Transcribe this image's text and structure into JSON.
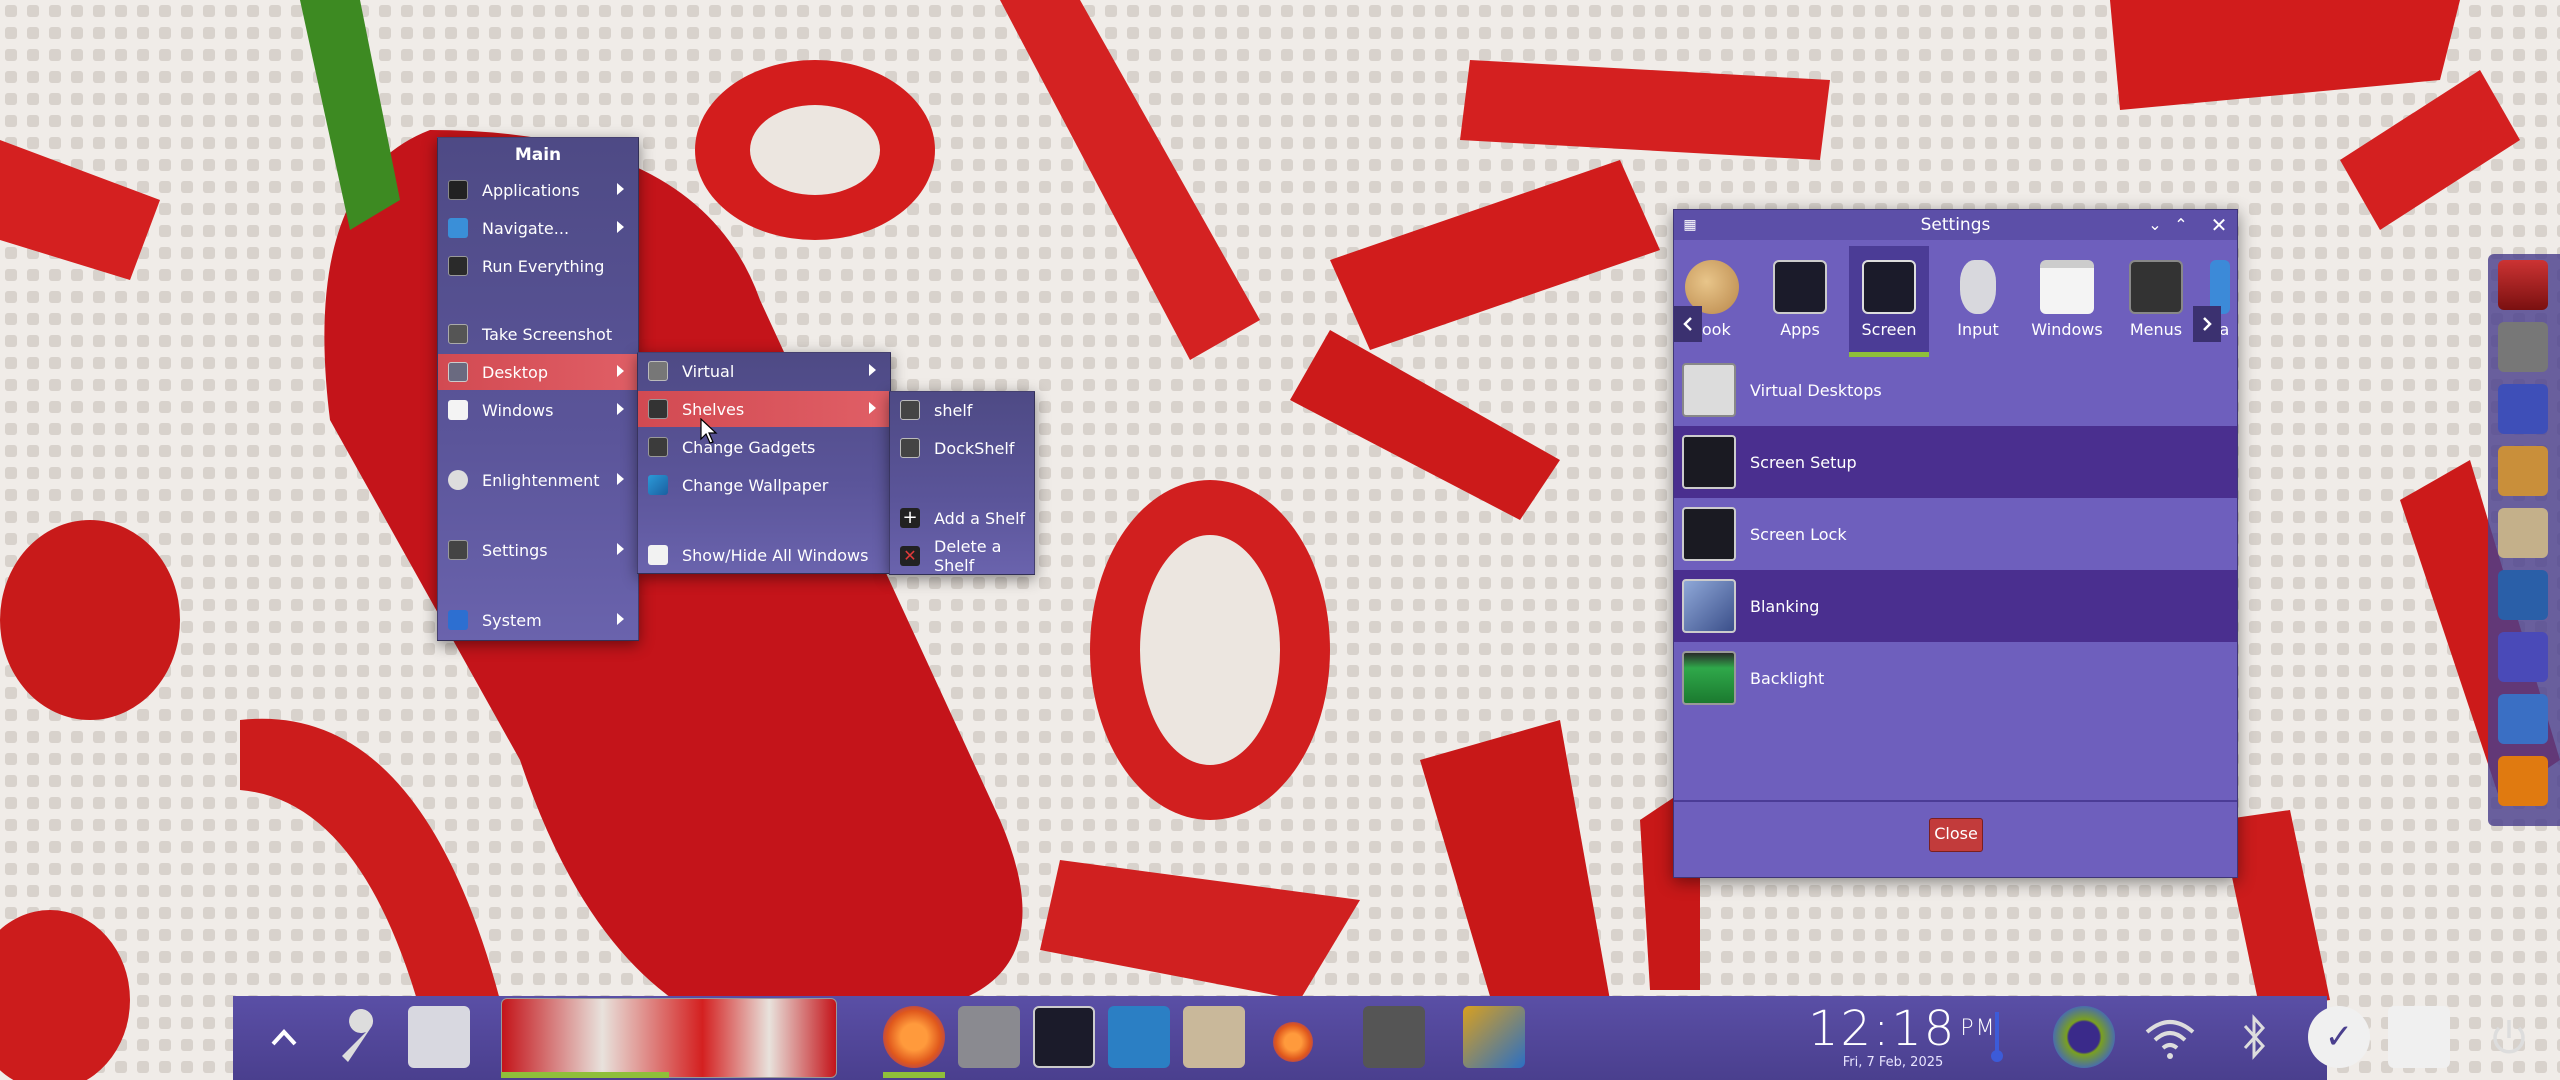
{
  "main_menu": {
    "title": "Main",
    "items": [
      {
        "label": "Applications",
        "icon": "terminal-icon",
        "submenu": true
      },
      {
        "label": "Navigate...",
        "icon": "navigate-icon",
        "submenu": true
      },
      {
        "label": "Run Everything",
        "icon": "search-icon",
        "submenu": false
      },
      {
        "label": "Take Screenshot",
        "icon": "screenshot-icon",
        "submenu": false
      },
      {
        "label": "Desktop",
        "icon": "desktop-icon",
        "submenu": true,
        "selected": true
      },
      {
        "label": "Windows",
        "icon": "windows-icon",
        "submenu": true
      },
      {
        "label": "Enlightenment",
        "icon": "enlightenment-icon",
        "submenu": true
      },
      {
        "label": "Settings",
        "icon": "settings-icon",
        "submenu": true
      },
      {
        "label": "System",
        "icon": "system-icon",
        "submenu": true
      }
    ]
  },
  "desktop_menu": {
    "items": [
      {
        "label": "Virtual",
        "icon": "virtual-desktops-icon",
        "submenu": true
      },
      {
        "label": "Shelves",
        "icon": "shelves-icon",
        "submenu": true,
        "selected": true
      },
      {
        "label": "Change Gadgets",
        "icon": "gadgets-icon",
        "submenu": false
      },
      {
        "label": "Change Wallpaper",
        "icon": "wallpaper-icon",
        "submenu": false
      },
      {
        "label": "Show/Hide All Windows",
        "icon": "show-hide-windows-icon",
        "submenu": false
      }
    ]
  },
  "shelves_menu": {
    "items": [
      {
        "label": "shelf",
        "icon": "shelf-icon"
      },
      {
        "label": "DockShelf",
        "icon": "dockshelf-icon"
      },
      {
        "label": "Add a Shelf",
        "icon": "plus-icon"
      },
      {
        "label": "Delete a Shelf",
        "icon": "delete-icon"
      }
    ]
  },
  "settings_window": {
    "title": "Settings",
    "tabs": [
      {
        "label": "Look",
        "icon": "palette-icon"
      },
      {
        "label": "Apps",
        "icon": "terminal-icon"
      },
      {
        "label": "Screen",
        "icon": "screen-icon",
        "active": true
      },
      {
        "label": "Input",
        "icon": "mouse-icon"
      },
      {
        "label": "Windows",
        "icon": "window-icon"
      },
      {
        "label": "Menus",
        "icon": "menu-icon"
      },
      {
        "label": "La",
        "icon": "language-icon"
      }
    ],
    "rows": [
      {
        "label": "Virtual Desktops",
        "icon": "sliders-icon"
      },
      {
        "label": "Screen Setup",
        "icon": "screen-setup-icon"
      },
      {
        "label": "Screen Lock",
        "icon": "lock-icon"
      },
      {
        "label": "Blanking",
        "icon": "blanking-icon"
      },
      {
        "label": "Backlight",
        "icon": "backlight-icon"
      }
    ],
    "close_label": "Close"
  },
  "shelf": {
    "clock_time": "12:18",
    "clock_ampm": "PM",
    "clock_date": "Fri, 7 Feb, 2025"
  },
  "colors": {
    "menu_bg": "#5b559a",
    "menu_selected": "#d24a52",
    "settings_bg": "#6e5fbd",
    "settings_row_dark": "#4a2f8f",
    "active_tab_indicator": "#8fbf3a",
    "close_button": "#c23b3b",
    "shelf_bg": "#5a4fa6"
  }
}
